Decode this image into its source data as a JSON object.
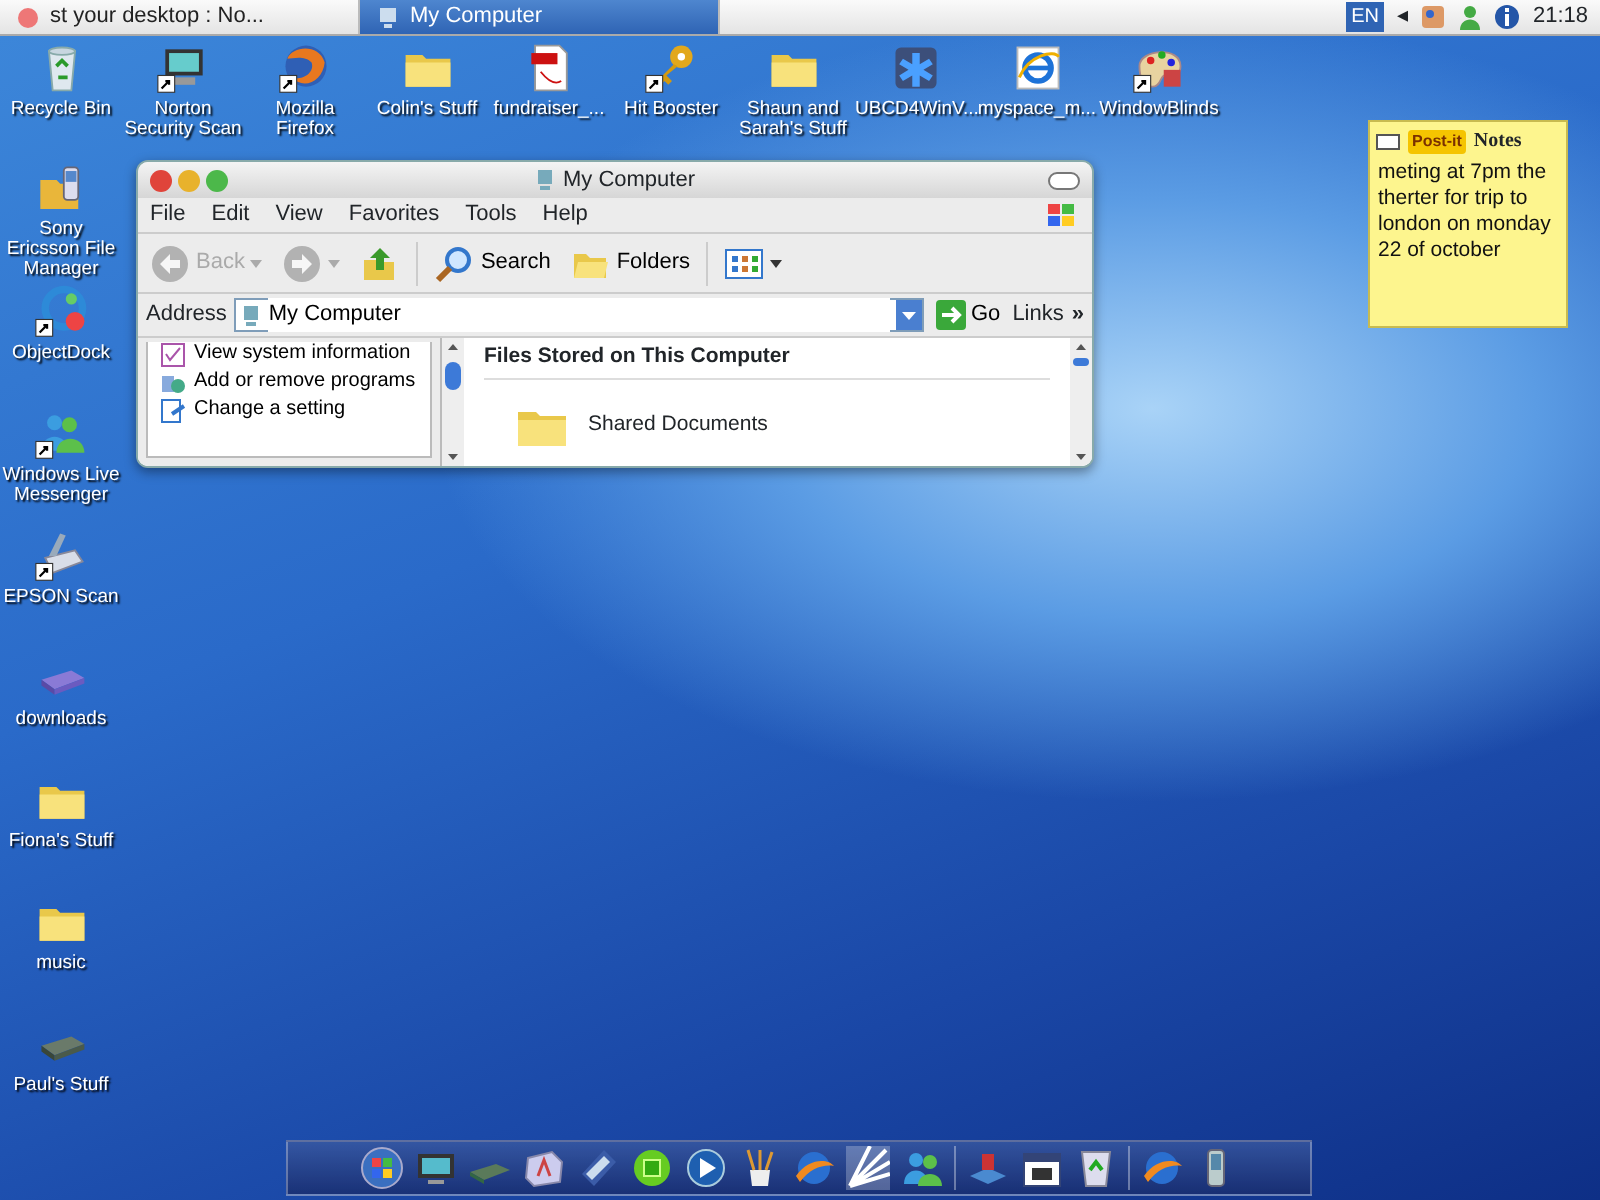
{
  "taskbar": {
    "tabs": [
      {
        "label": "st your desktop : No...",
        "selected": false
      },
      {
        "label": "My Computer",
        "selected": true
      }
    ],
    "language": "EN",
    "tray_arrow": "◂",
    "clock": "21:18"
  },
  "desktop": {
    "top_row_icons": [
      {
        "label": "Recycle Bin",
        "kind": "recycle-bin",
        "shortcut": false
      },
      {
        "label": "Norton Security Scan",
        "kind": "monitor",
        "shortcut": true
      },
      {
        "label": "Mozilla Firefox",
        "kind": "globe",
        "shortcut": true
      },
      {
        "label": "Colin's Stuff",
        "kind": "folder",
        "shortcut": false
      },
      {
        "label": "fundraiser_...",
        "kind": "pdf",
        "shortcut": false
      },
      {
        "label": "Hit Booster",
        "kind": "key",
        "shortcut": true
      },
      {
        "label": "Shaun and Sarah's Stuff",
        "kind": "folder",
        "shortcut": false
      },
      {
        "label": "UBCD4WinV...",
        "kind": "medical",
        "shortcut": false
      },
      {
        "label": "myspace_m...",
        "kind": "browser",
        "shortcut": false
      },
      {
        "label": "WindowBlinds",
        "kind": "palette",
        "shortcut": true
      }
    ],
    "left_column_icons": [
      {
        "label": "Sony Ericsson File Manager",
        "kind": "phone-folder",
        "shortcut": false
      },
      {
        "label": "ObjectDock",
        "kind": "dock",
        "shortcut": true
      },
      {
        "label": "Windows Live Messenger",
        "kind": "people",
        "shortcut": true
      },
      {
        "label": "EPSON Scan",
        "kind": "scanner",
        "shortcut": true
      },
      {
        "label": "downloads",
        "kind": "drive",
        "shortcut": false
      },
      {
        "label": "Fiona's Stuff",
        "kind": "folder",
        "shortcut": false
      },
      {
        "label": "music",
        "kind": "folder",
        "shortcut": false
      },
      {
        "label": "Paul's Stuff",
        "kind": "drive-dark",
        "shortcut": false
      }
    ]
  },
  "window": {
    "title": "My Computer",
    "menu": [
      "File",
      "Edit",
      "View",
      "Favorites",
      "Tools",
      "Help"
    ],
    "toolbar": [
      {
        "kind": "back",
        "label": "Back",
        "disabled": true
      },
      {
        "kind": "forward",
        "disabled": true
      },
      {
        "kind": "up",
        "disabled": false
      },
      {
        "kind": "search",
        "label": "Search",
        "disabled": false
      },
      {
        "kind": "folders",
        "label": "Folders",
        "disabled": false
      },
      {
        "kind": "views",
        "disabled": false
      }
    ],
    "address": {
      "label": "Address",
      "value": "My Computer",
      "go": "Go",
      "links": "Links",
      "more": "»"
    },
    "tasks": [
      {
        "label": "View system information",
        "kind": "info"
      },
      {
        "label": "Add or remove programs",
        "kind": "programs"
      },
      {
        "label": "Change a setting",
        "kind": "setting"
      }
    ],
    "section_title": "Files Stored on This Computer",
    "items": [
      {
        "label": "Shared Documents",
        "kind": "folder"
      }
    ]
  },
  "notes": {
    "brand": "Post-it",
    "title": "Notes",
    "text": "meting at 7pm the therter for trip to london on monday 22 of october"
  }
}
